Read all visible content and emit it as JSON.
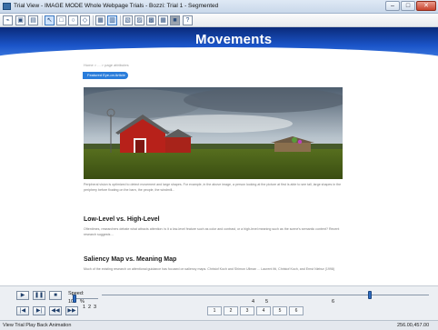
{
  "window": {
    "title": "Trial View - IMAGE MODE   Whole Webpage Trials - Bozzi: Trial 1 - Segmented",
    "min": "–",
    "max": "□",
    "close": "✕"
  },
  "toolbar": {
    "icons": [
      "chart-line-icon",
      "image-icon",
      "layout-icon",
      "pointer-icon",
      "rectangle-icon",
      "ellipse-icon",
      "freeform-icon",
      "grid-icon",
      "split-icon",
      "aoi-icon",
      "aoi-copy-icon",
      "aoi-save-icon",
      "aoi-group-icon",
      "heatmap-icon",
      "help-icon"
    ]
  },
  "page": {
    "hero_title": "Movements",
    "breadcrumb": "Home > ... > page attributes",
    "tag": "Featured Eye-on Article",
    "heading1": "Low-Level vs. High-Level",
    "heading2": "Saliency Map vs. Meaning Map",
    "para1": "Peripheral vision is optimized to detect movement and large shapes. For example, in the above image, a person looking at the picture at first is able to see tall, large shapes in the periphery before fixating on the barn, the people, the windmill...",
    "para2": "Oftentimes, researchers debate what attracts attention: is it a low-level feature such as color and contrast, or a high-level meaning such as the scene's semantic content? Recent research suggests ...",
    "para3": "Much of the existing research on attentional guidance has focused on saliency maps. Christof Koch and Shimon Ullman ... Laurent Itti, Christof Koch, and Ernst Niebur (1998)"
  },
  "controls": {
    "speed_label": "Speed:",
    "speed_value": "100",
    "speed_unit": "%",
    "speed_ticks": [
      "1",
      "2",
      "3"
    ],
    "timeline_ticks": [
      "4",
      "5",
      "6"
    ],
    "page_buttons": [
      "1",
      "2",
      "3",
      "4",
      "5",
      "6"
    ],
    "play_icons": [
      "▶",
      "⏸",
      "⏹",
      "⏮",
      "⏭",
      "⏪",
      "⏩"
    ],
    "playback_progress": 0.82
  },
  "status": {
    "left": "View Trial Play Back Animation",
    "right": "256.00,457.00"
  }
}
